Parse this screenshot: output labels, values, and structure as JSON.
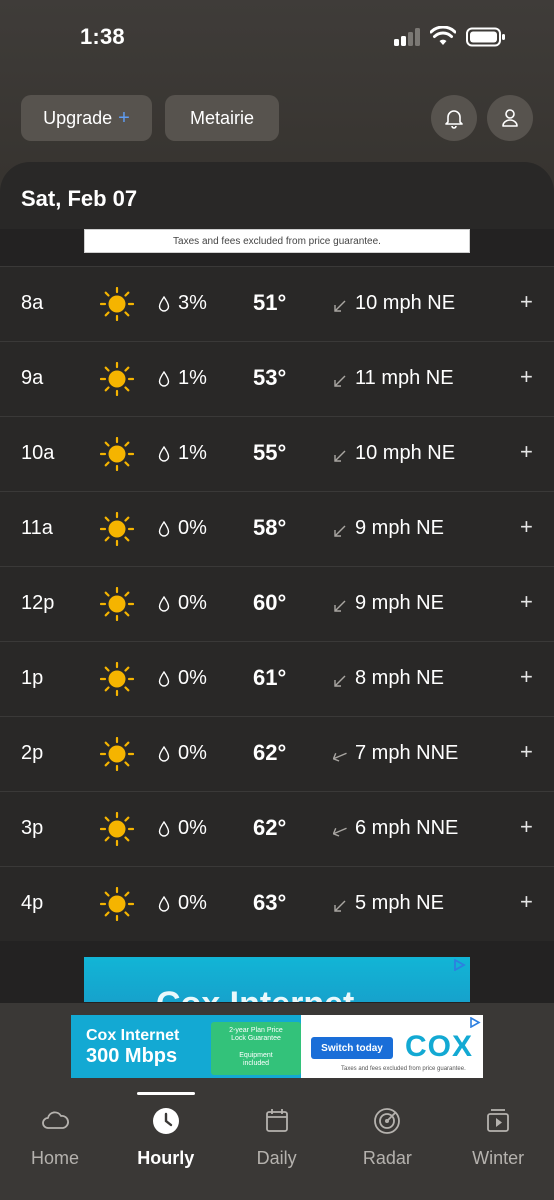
{
  "status": {
    "time": "1:38"
  },
  "header": {
    "upgrade_label": "Upgrade",
    "upgrade_plus": "+",
    "location_label": "Metairie"
  },
  "day": {
    "title": "Sat, Feb 07"
  },
  "ads": {
    "strip_text": "Taxes and fees excluded from price guarantee.",
    "big_text": "Cox Internet",
    "banner": {
      "headline1": "Cox Internet",
      "headline2": "300 Mbps",
      "badge_line1": "2-year Plan Price",
      "badge_line2": "Lock Guarantee",
      "badge_line3": "Equipment",
      "badge_line4": "included",
      "cta": "Switch today",
      "logo": "COX",
      "fine_print": "Taxes and fees excluded from price guarantee."
    }
  },
  "hours": [
    {
      "time": "8a",
      "icon": "sun-icon",
      "precip": "3%",
      "temp": "51°",
      "wind": "10 mph NE",
      "wind_dir": "NE"
    },
    {
      "time": "9a",
      "icon": "sun-icon",
      "precip": "1%",
      "temp": "53°",
      "wind": "11 mph NE",
      "wind_dir": "NE"
    },
    {
      "time": "10a",
      "icon": "sun-icon",
      "precip": "1%",
      "temp": "55°",
      "wind": "10 mph NE",
      "wind_dir": "NE"
    },
    {
      "time": "11a",
      "icon": "sun-icon",
      "precip": "0%",
      "temp": "58°",
      "wind": "9 mph NE",
      "wind_dir": "NE"
    },
    {
      "time": "12p",
      "icon": "sun-icon",
      "precip": "0%",
      "temp": "60°",
      "wind": "9 mph NE",
      "wind_dir": "NE"
    },
    {
      "time": "1p",
      "icon": "sun-icon",
      "precip": "0%",
      "temp": "61°",
      "wind": "8 mph NE",
      "wind_dir": "NE"
    },
    {
      "time": "2p",
      "icon": "sun-icon",
      "precip": "0%",
      "temp": "62°",
      "wind": "7 mph NNE",
      "wind_dir": "NNE"
    },
    {
      "time": "3p",
      "icon": "sun-icon",
      "precip": "0%",
      "temp": "62°",
      "wind": "6 mph NNE",
      "wind_dir": "NNE"
    },
    {
      "time": "4p",
      "icon": "sun-icon",
      "precip": "0%",
      "temp": "63°",
      "wind": "5 mph NE",
      "wind_dir": "NE"
    }
  ],
  "expand_symbol": "+",
  "tabs": [
    {
      "label": "Home",
      "icon": "cloud-icon"
    },
    {
      "label": "Hourly",
      "icon": "clock-icon",
      "active": true
    },
    {
      "label": "Daily",
      "icon": "calendar-icon"
    },
    {
      "label": "Radar",
      "icon": "radar-icon"
    },
    {
      "label": "Winter",
      "icon": "video-icon"
    }
  ],
  "colors": {
    "accent": "#5f9cf2",
    "sun": "#f5b400",
    "background": "#292827"
  }
}
